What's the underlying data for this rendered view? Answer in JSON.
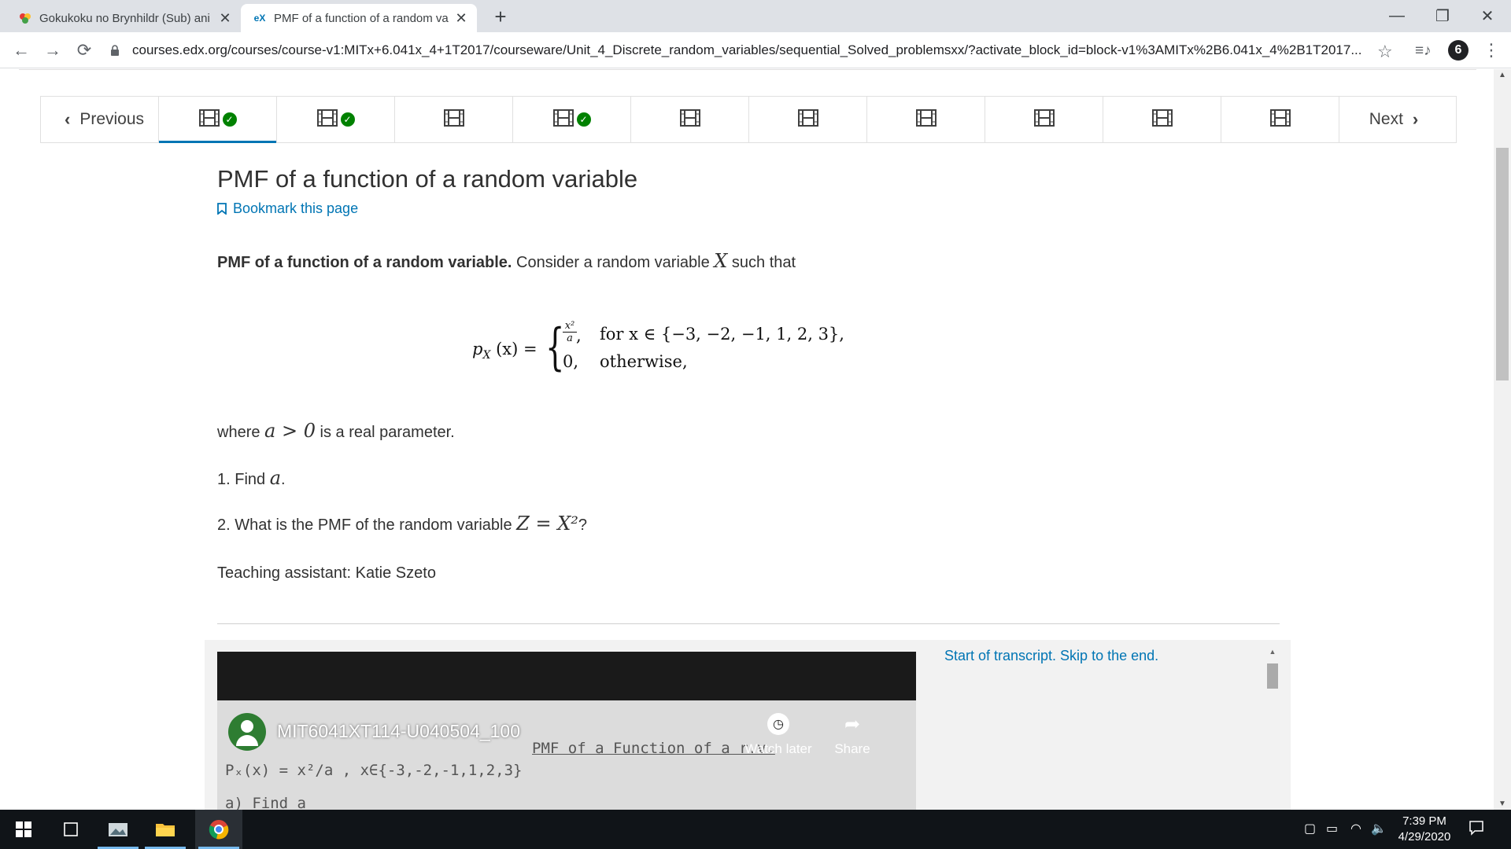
{
  "browser": {
    "tabs": [
      {
        "title": "Gokukoku no Brynhildr (Sub) ani",
        "active": false
      },
      {
        "title": "PMF of a function of a random va",
        "active": true
      }
    ],
    "tab_close": "✕",
    "new_tab": "+",
    "window_controls": {
      "minimize": "—",
      "restore": "❐",
      "close": "✕"
    },
    "url": "courses.edx.org/courses/course-v1:MITx+6.041x_4+1T2017/courseware/Unit_4_Discrete_random_variables/sequential_Solved_problemsxx/?activate_block_id=block-v1%3AMITx%2B6.041x_4%2B1T2017..."
  },
  "sequence_nav": {
    "previous_label": "Previous",
    "next_label": "Next",
    "units": [
      {
        "completed": true,
        "active": true
      },
      {
        "completed": true,
        "active": false
      },
      {
        "completed": false,
        "active": false
      },
      {
        "completed": true,
        "active": false
      },
      {
        "completed": false,
        "active": false
      },
      {
        "completed": false,
        "active": false
      },
      {
        "completed": false,
        "active": false
      },
      {
        "completed": false,
        "active": false
      },
      {
        "completed": false,
        "active": false
      },
      {
        "completed": false,
        "active": false
      }
    ]
  },
  "page": {
    "title": "PMF of a function of a random variable",
    "bookmark_label": "Bookmark this page",
    "intro_bold": "PMF of a function of a random variable.",
    "intro_text": " Consider a random variable ",
    "intro_var": "X",
    "intro_tail": " such that",
    "formula": {
      "lhs": "p",
      "lhs_sub": "X",
      "lhs_arg": " (x) =",
      "case1_num": "x²",
      "case1_den": "a",
      "case1_cond": "for x ∈ {−3, −2, −1, 1, 2, 3},",
      "case2_val": "0,",
      "case2_cond": "otherwise,"
    },
    "where_text_1": "where ",
    "where_math": "a > 0",
    "where_text_2": " is a real parameter.",
    "q1_text": "1. Find ",
    "q1_math": "a",
    "q1_tail": ".",
    "q2_text": "2. What is the PMF of the random variable ",
    "q2_math": "Z = X²",
    "q2_tail": "?",
    "ta_text": "Teaching assistant: Katie Szeto"
  },
  "video": {
    "title": "MIT6041XT114-U040504_100",
    "handwriting_1": "Pₓ(x) = x²/a ,  x∈{-3,-2,-1,1,2,3}",
    "handwriting_2": "PMF of a Function of a r.v.",
    "handwriting_3": "a) Find a",
    "watch_later": "Watch later",
    "share": "Share",
    "transcript_link": "Start of transcript. Skip to the end."
  },
  "taskbar": {
    "time": "7:39 PM",
    "date": "4/29/2020"
  },
  "colors": {
    "accent": "#0075b4",
    "check": "#008100",
    "text": "#313131"
  }
}
